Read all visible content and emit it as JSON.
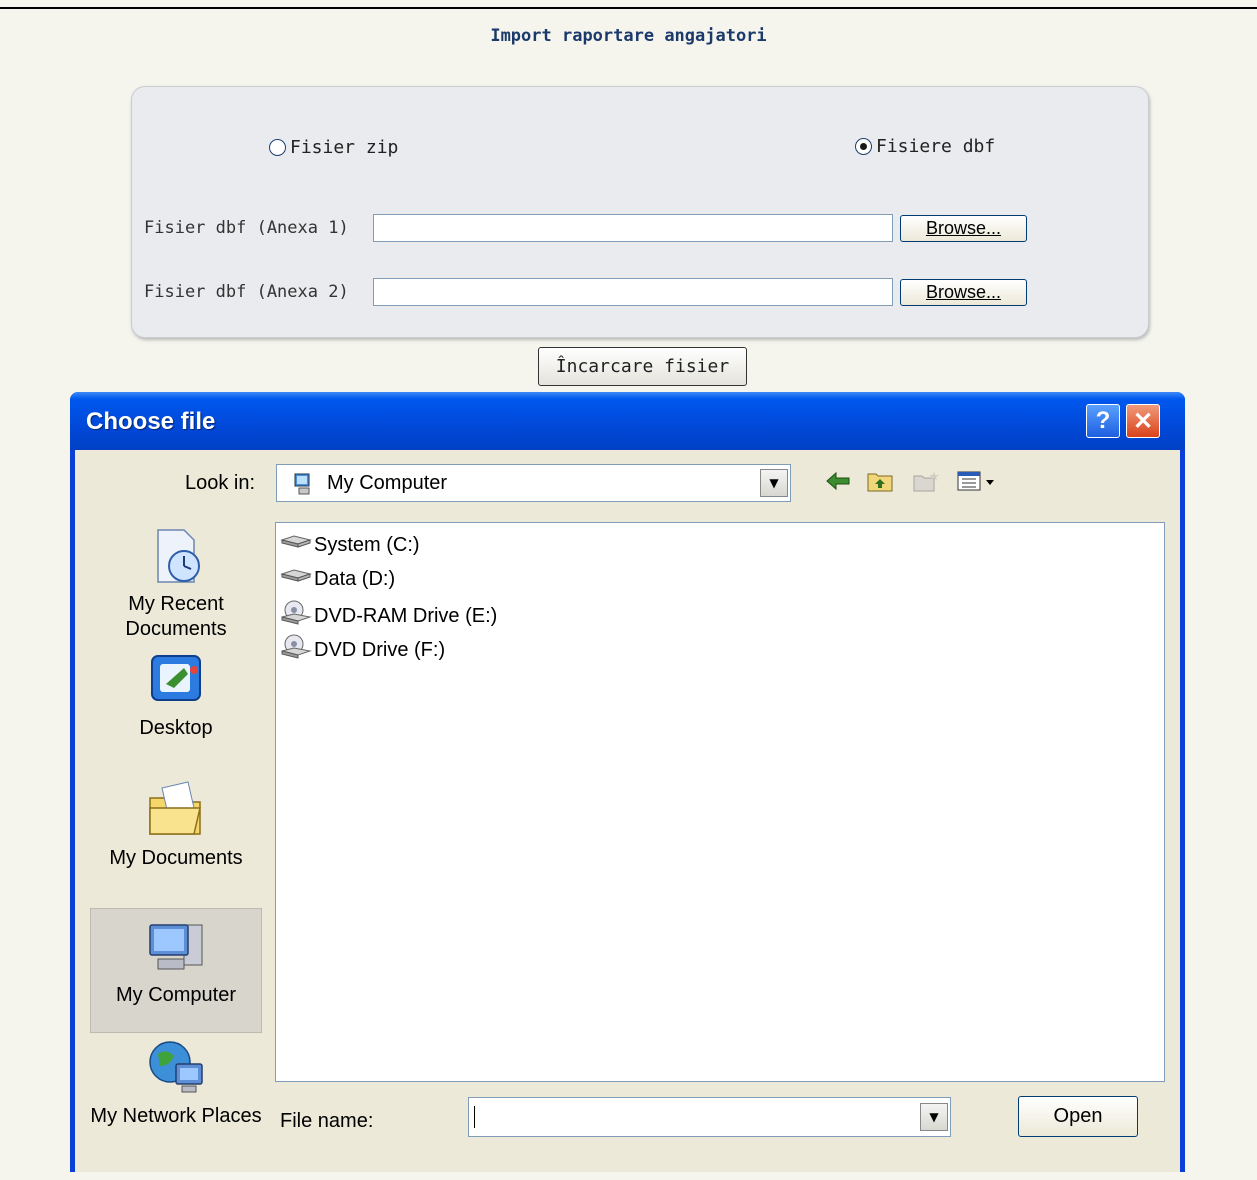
{
  "page": {
    "title": "Import raportare angajatori"
  },
  "form": {
    "radio_zip_label": "Fisier zip",
    "radio_dbf_label": "Fisiere dbf",
    "selected_option": "Fisiere dbf",
    "anexa1_label": "Fisier dbf (Anexa 1)",
    "anexa1_value": "",
    "anexa2_label": "Fisier dbf (Anexa 2)",
    "anexa2_value": "",
    "browse_label": "Browse...",
    "upload_label": "Încarcare fisier"
  },
  "dialog": {
    "title": "Choose file",
    "help_label": "?",
    "close_label": "✕",
    "look_in_label": "Look in:",
    "look_in_value": "My Computer",
    "toolbar_icons": [
      "back-icon",
      "up-folder-icon",
      "new-folder-icon",
      "view-menu-icon"
    ],
    "places": [
      {
        "label": "My Recent Documents",
        "icon": "recent-documents-icon"
      },
      {
        "label": "Desktop",
        "icon": "desktop-icon"
      },
      {
        "label": "My Documents",
        "icon": "my-documents-icon"
      },
      {
        "label": "My Computer",
        "icon": "my-computer-icon",
        "selected": true
      },
      {
        "label": "My Network Places",
        "icon": "network-places-icon"
      }
    ],
    "files": [
      {
        "label": "System (C:)",
        "icon": "hard-drive-icon"
      },
      {
        "label": "Data (D:)",
        "icon": "hard-drive-icon"
      },
      {
        "label": "DVD-RAM Drive (E:)",
        "icon": "dvd-drive-icon"
      },
      {
        "label": "DVD Drive (F:)",
        "icon": "dvd-drive-icon"
      }
    ],
    "file_name_label": "File name:",
    "file_name_value": "",
    "open_label": "Open"
  }
}
